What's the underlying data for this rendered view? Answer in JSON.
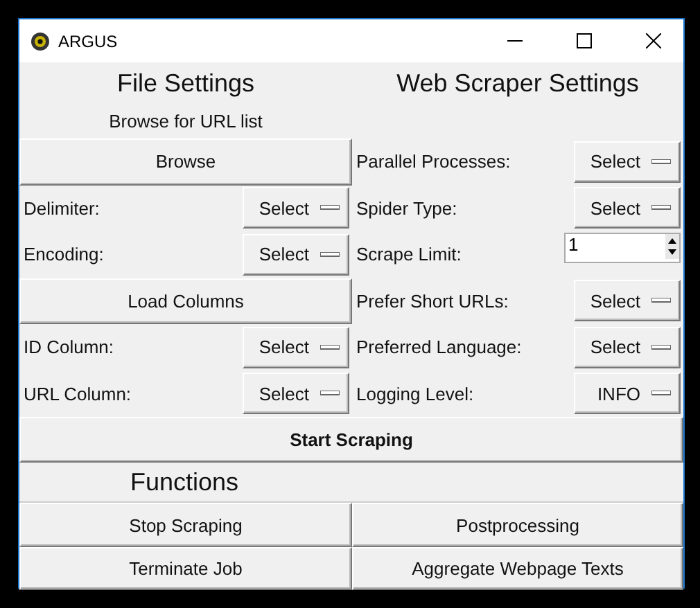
{
  "window": {
    "title": "ARGUS"
  },
  "file_settings": {
    "title": "File Settings",
    "subtitle": "Browse for URL list",
    "rows": [
      {
        "kind": "button",
        "label": "Browse"
      },
      {
        "kind": "select",
        "label": "Delimiter:",
        "value": "Select"
      },
      {
        "kind": "select",
        "label": "Encoding:",
        "value": "Select"
      },
      {
        "kind": "button",
        "label": "Load Columns"
      },
      {
        "kind": "select",
        "label": "ID Column:",
        "value": "Select"
      },
      {
        "kind": "select",
        "label": "URL Column:",
        "value": "Select"
      }
    ]
  },
  "web_scraper_settings": {
    "title": "Web Scraper Settings",
    "rows": [
      {
        "kind": "select",
        "label": "Parallel Processes:",
        "value": "Select"
      },
      {
        "kind": "select",
        "label": "Spider Type:",
        "value": "Select"
      },
      {
        "kind": "spinbox",
        "label": "Scrape Limit:",
        "value": "1"
      },
      {
        "kind": "select",
        "label": "Prefer Short URLs:",
        "value": "Select"
      },
      {
        "kind": "select",
        "label": "Preferred Language:",
        "value": "Select"
      },
      {
        "kind": "select",
        "label": "Logging Level:",
        "value": "INFO"
      }
    ]
  },
  "start_button": "Start Scraping",
  "functions": {
    "title": "Functions",
    "buttons": [
      "Stop Scraping",
      "Postprocessing",
      "Terminate Job",
      "Aggregate Webpage Texts"
    ]
  }
}
